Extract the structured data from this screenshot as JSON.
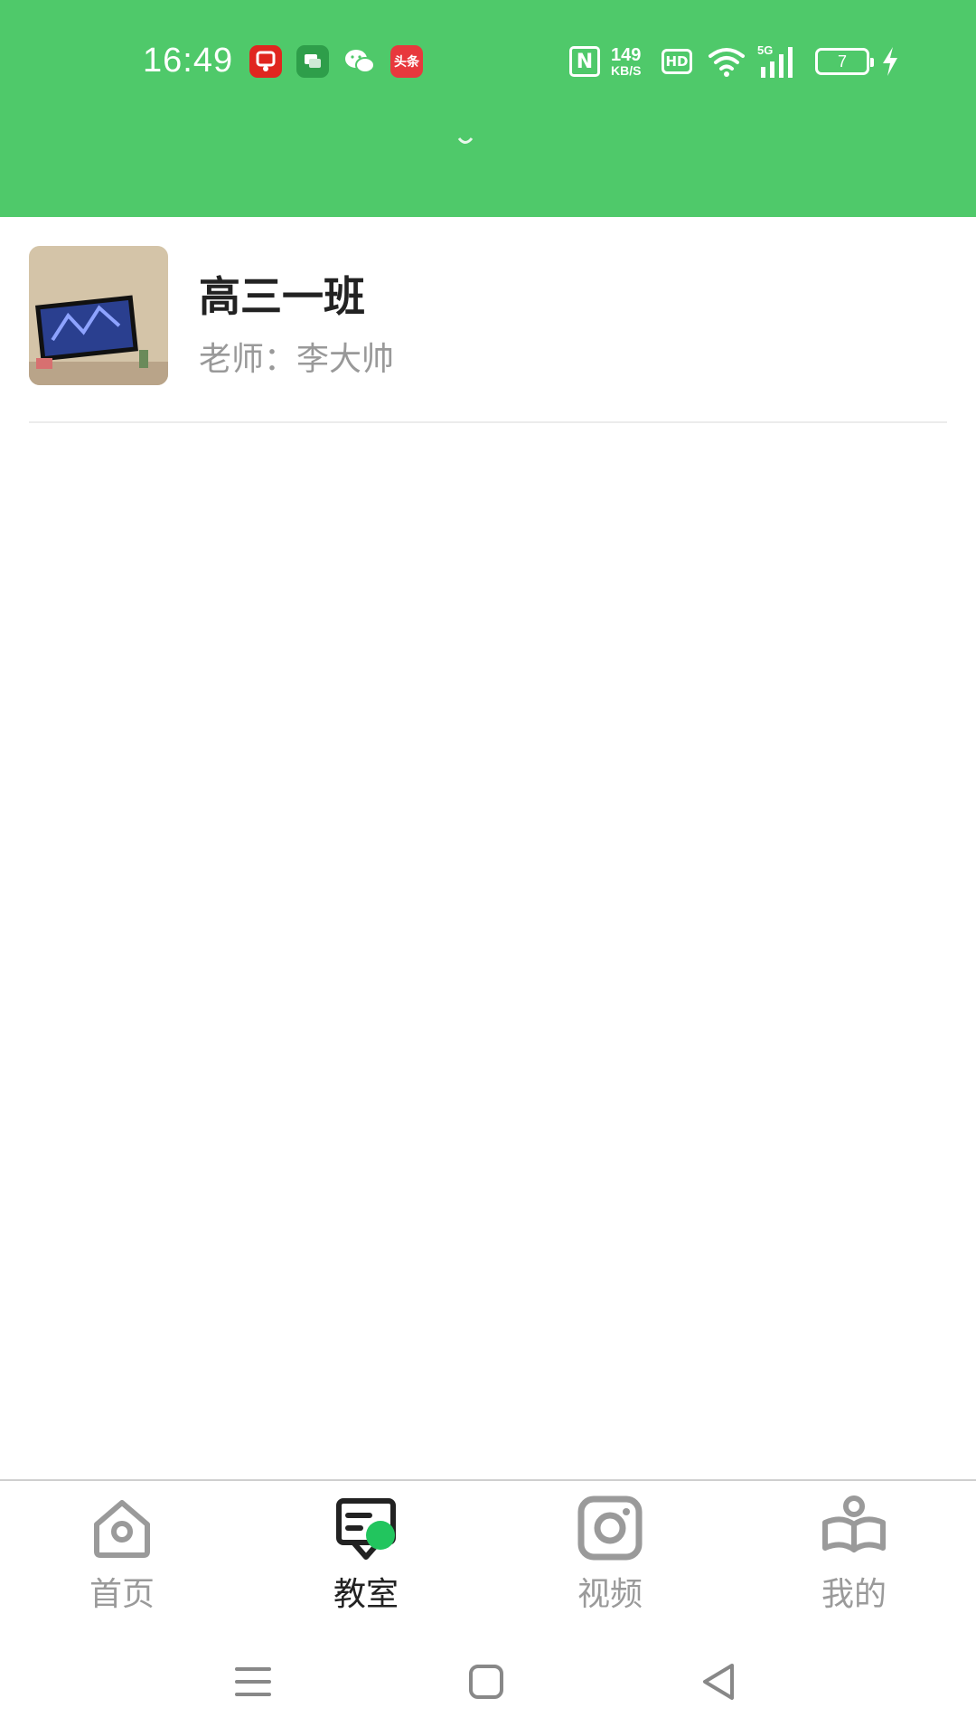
{
  "status_bar": {
    "time": "16:49",
    "notification_icons": [
      "pdd-app-icon",
      "message-app-icon",
      "wechat-icon",
      "toutiao-icon"
    ],
    "toutiao_label": "头条",
    "nfc_label": "N",
    "speed_value": "149",
    "speed_unit": "KB/S",
    "hd_label": "HD",
    "network_label": "5G",
    "battery_level": "7"
  },
  "class_list": [
    {
      "name": "高三一班",
      "teacher": "老师：李大帅"
    }
  ],
  "tabs": [
    {
      "label": "首页",
      "icon": "home-icon",
      "active": false
    },
    {
      "label": "教室",
      "icon": "classroom-icon",
      "active": true
    },
    {
      "label": "视频",
      "icon": "video-icon",
      "active": false
    },
    {
      "label": "我的",
      "icon": "profile-icon",
      "active": false
    }
  ],
  "colors": {
    "header_green": "#4fc96a",
    "active_badge_green": "#22c55e",
    "inactive_tab": "#9a9a9a"
  }
}
